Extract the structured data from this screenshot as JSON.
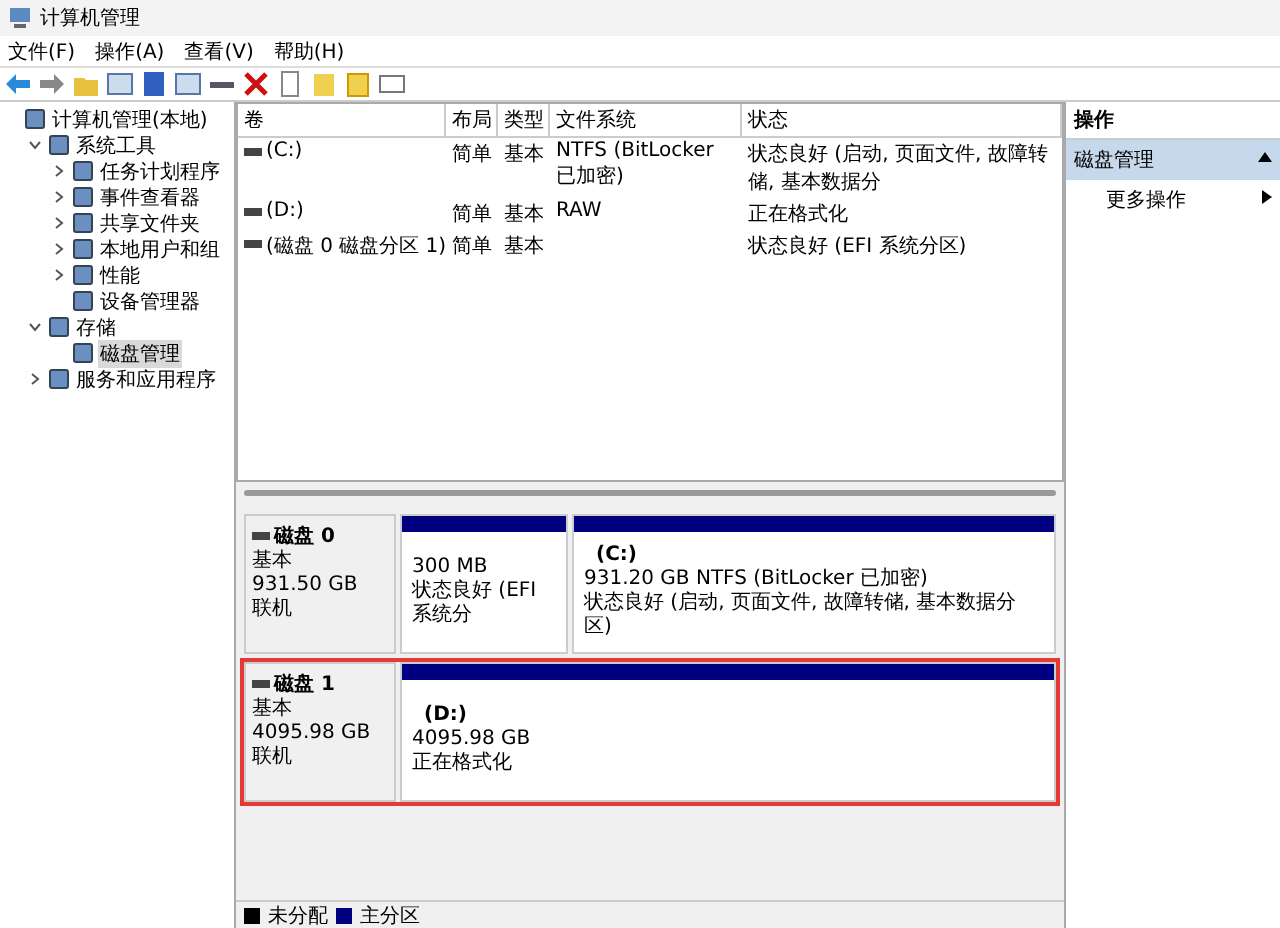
{
  "window": {
    "title": "计算机管理"
  },
  "menu": [
    "文件(F)",
    "操作(A)",
    "查看(V)",
    "帮助(H)"
  ],
  "tree": [
    {
      "label": "计算机管理(本地)",
      "selected": false,
      "children": [
        {
          "label": "系统工具",
          "expanded": true,
          "selected": false,
          "children": [
            {
              "label": "任务计划程序",
              "expanded": false,
              "selected": false
            },
            {
              "label": "事件查看器",
              "expanded": false,
              "selected": false
            },
            {
              "label": "共享文件夹",
              "expanded": false,
              "selected": false
            },
            {
              "label": "本地用户和组",
              "expanded": false,
              "selected": false
            },
            {
              "label": "性能",
              "expanded": false,
              "selected": false
            },
            {
              "label": "设备管理器",
              "selected": false
            }
          ]
        },
        {
          "label": "存储",
          "expanded": true,
          "selected": false,
          "children": [
            {
              "label": "磁盘管理",
              "selected": true
            }
          ]
        },
        {
          "label": "服务和应用程序",
          "expanded": false,
          "selected": false
        }
      ]
    }
  ],
  "table": {
    "columns": [
      "卷",
      "布局",
      "类型",
      "文件系统",
      "状态"
    ],
    "rows": [
      [
        "(C:)",
        "简单",
        "基本",
        "NTFS (BitLocker 已加密)",
        "状态良好 (启动, 页面文件, 故障转储, 基本数据分"
      ],
      [
        "(D:)",
        "简单",
        "基本",
        "RAW",
        "正在格式化"
      ],
      [
        "(磁盘 0 磁盘分区 1)",
        "简单",
        "基本",
        "",
        "状态良好 (EFI 系统分区)"
      ]
    ]
  },
  "disks": [
    {
      "name": "磁盘 0",
      "type": "基本",
      "size": "931.50 GB",
      "status": "联机",
      "highlighted": false,
      "partitions": [
        {
          "size": "300 MB",
          "status": "状态良好 (EFI 系统分"
        },
        {
          "label": "(C:)",
          "size": "931.20 GB NTFS (BitLocker 已加密)",
          "status": "状态良好 (启动, 页面文件, 故障转储, 基本数据分区)"
        }
      ]
    },
    {
      "name": "磁盘 1",
      "type": "基本",
      "size": "4095.98 GB",
      "status": "联机",
      "highlighted": true,
      "partitions": [
        {
          "label": "(D:)",
          "size": "4095.98 GB",
          "status": "正在格式化"
        }
      ]
    }
  ],
  "legend": [
    {
      "label": "未分配",
      "color": "#000000"
    },
    {
      "label": "主分区",
      "color": "#000080"
    }
  ],
  "actions": {
    "title": "操作",
    "section": "磁盘管理",
    "items": [
      "更多操作"
    ]
  }
}
